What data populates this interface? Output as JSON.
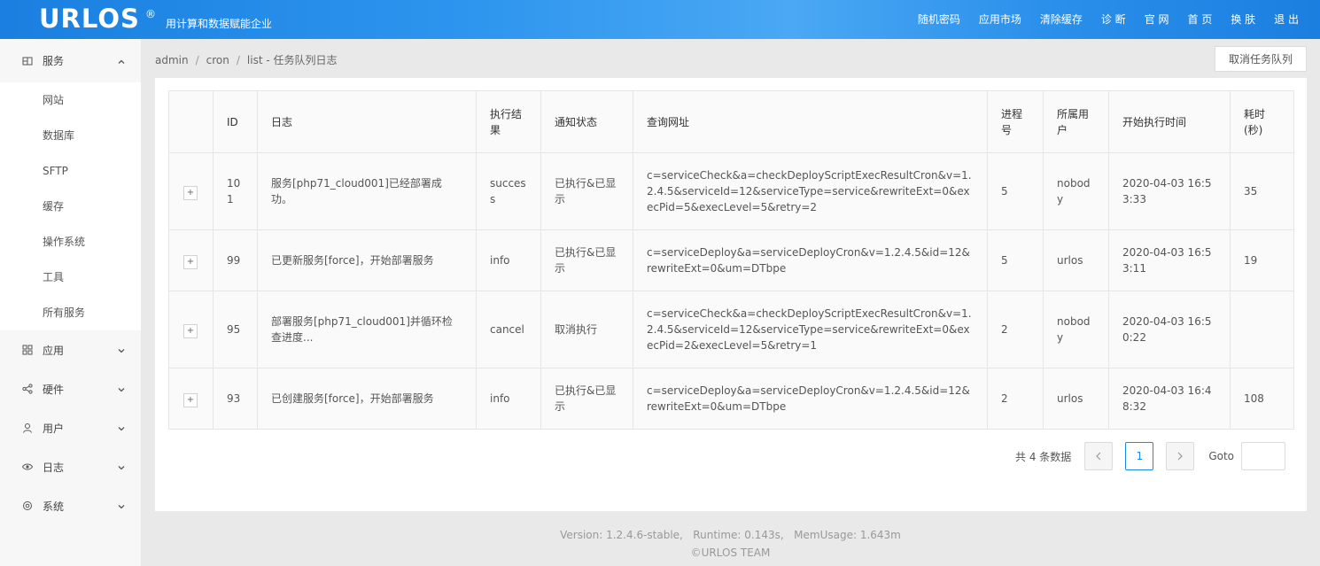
{
  "header": {
    "logo": "URLOS",
    "logo_mark": "®",
    "slogan": "用计算和数据赋能企业",
    "nav": [
      "随机密码",
      "应用市场",
      "清除缓存",
      "诊 断",
      "官 网",
      "首 页",
      "换 肤",
      "退 出"
    ]
  },
  "sidebar": {
    "service": {
      "label": "服务",
      "icon": "grid-box-icon"
    },
    "sub_items": [
      "网站",
      "数据库",
      "SFTP",
      "缓存",
      "操作系统",
      "工具",
      "所有服务"
    ],
    "app": {
      "label": "应用",
      "icon": "apps-icon"
    },
    "hardware": {
      "label": "硬件",
      "icon": "share-icon"
    },
    "user": {
      "label": "用户",
      "icon": "user-icon"
    },
    "log": {
      "label": "日志",
      "icon": "eye-icon"
    },
    "system": {
      "label": "系统",
      "icon": "gear-icon"
    }
  },
  "breadcrumb": {
    "parts": [
      "admin",
      "cron",
      "list"
    ],
    "title": "任务队列日志"
  },
  "actions": {
    "cancel_queue": "取消任务队列"
  },
  "table": {
    "headers": [
      "",
      "ID",
      "日志",
      "执行结果",
      "通知状态",
      "查询网址",
      "进程号",
      "所属用户",
      "开始执行时间",
      "耗时(秒)"
    ],
    "rows": [
      {
        "expand": "+",
        "id": "101",
        "log": "服务[php71_cloud001]已经部署成功。",
        "result": "success",
        "notify": "已执行&已显示",
        "url": "c=serviceCheck&a=checkDeployScriptExecResultCron&v=1.2.4.5&serviceId=12&serviceType=service&rewriteExt=0&execPid=5&execLevel=5&retry=2",
        "pid": "5",
        "user": "nobody",
        "start": "2020-04-03 16:53:33",
        "cost": "35"
      },
      {
        "expand": "+",
        "id": "99",
        "log": "已更新服务[force]，开始部署服务",
        "result": "info",
        "notify": "已执行&已显示",
        "url": "c=serviceDeploy&a=serviceDeployCron&v=1.2.4.5&id=12&rewriteExt=0&um=DTbpe",
        "pid": "5",
        "user": "urlos",
        "start": "2020-04-03 16:53:11",
        "cost": "19"
      },
      {
        "expand": "+",
        "id": "95",
        "log": "部署服务[php71_cloud001]并循环检查进度...",
        "result": "cancel",
        "notify": "取消执行",
        "url": "c=serviceCheck&a=checkDeployScriptExecResultCron&v=1.2.4.5&serviceId=12&serviceType=service&rewriteExt=0&execPid=2&execLevel=5&retry=1",
        "pid": "2",
        "user": "nobody",
        "start": "2020-04-03 16:50:22",
        "cost": ""
      },
      {
        "expand": "+",
        "id": "93",
        "log": "已创建服务[force]，开始部署服务",
        "result": "info",
        "notify": "已执行&已显示",
        "url": "c=serviceDeploy&a=serviceDeployCron&v=1.2.4.5&id=12&rewriteExt=0&um=DTbpe",
        "pid": "2",
        "user": "urlos",
        "start": "2020-04-03 16:48:32",
        "cost": "108"
      }
    ]
  },
  "pagination": {
    "total": "共 4 条数据",
    "prev": "<",
    "current": "1",
    "next": ">",
    "goto_label": "Goto",
    "goto_value": ""
  },
  "footer": {
    "line1": "Version: 1.2.4.6-stable,   Runtime: 0.143s,   MemUsage: 1.643m",
    "line2": "©URLOS TEAM"
  },
  "colors": {
    "header_blue": "#2d95ee",
    "accent": "#1e88e5"
  }
}
